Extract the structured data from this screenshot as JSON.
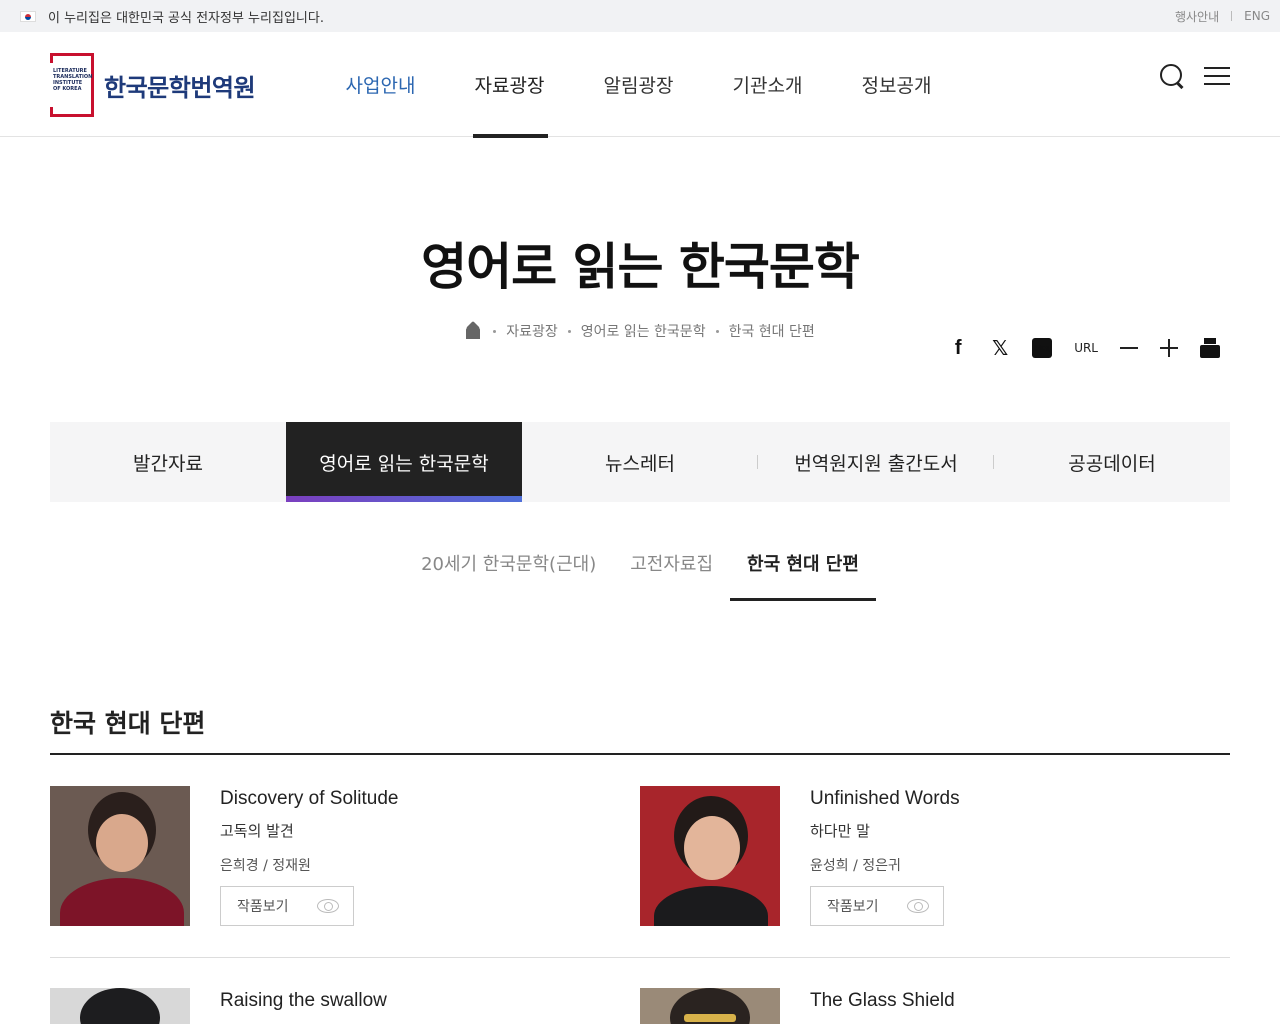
{
  "gov_banner": {
    "text": "이 누리집은 대한민국 공식 전자정부 누리집입니다.",
    "links": [
      "행사안내",
      "ENG"
    ]
  },
  "header": {
    "logo_text": "한국문학번역원",
    "logo_mini": "LITERATURE TRANSLATION INSTITUTE OF KOREA",
    "nav": [
      "사업안내",
      "자료광장",
      "알림광장",
      "기관소개",
      "정보공개"
    ],
    "active_nav": "자료광장",
    "icons": [
      "search-icon",
      "menu-icon"
    ]
  },
  "page": {
    "title": "영어로 읽는 한국문학",
    "breadcrumb": [
      "자료광장",
      "영어로 읽는 한국문학",
      "한국 현대 단편"
    ],
    "share": {
      "url_label": "URL"
    }
  },
  "tabs": [
    "발간자료",
    "영어로 읽는 한국문학",
    "뉴스레터",
    "번역원지원 출간도서",
    "공공데이터"
  ],
  "active_tab": "영어로 읽는 한국문학",
  "subtabs": [
    "20세기 한국문학(근대)",
    "고전자료집",
    "한국 현대 단편"
  ],
  "active_subtab": "한국 현대 단편",
  "section": {
    "title": "한국 현대 단편",
    "items": [
      {
        "en": "Discovery of Solitude",
        "ko": "고독의 발견",
        "authors": "은희경 / 정재원",
        "button": "작품보기"
      },
      {
        "en": "Unfinished Words",
        "ko": "하다만 말",
        "authors": "윤성희 / 정은귀",
        "button": "작품보기"
      },
      {
        "en": "Raising the swallow",
        "ko": "",
        "authors": "",
        "button": ""
      },
      {
        "en": "The Glass Shield",
        "ko": "",
        "authors": "",
        "button": ""
      }
    ]
  },
  "colors": {
    "brand_red": "#c8102e",
    "brand_navy": "#1e3a7a",
    "nav_blue": "#2c67b1",
    "tab_active_bg": "#222222"
  }
}
